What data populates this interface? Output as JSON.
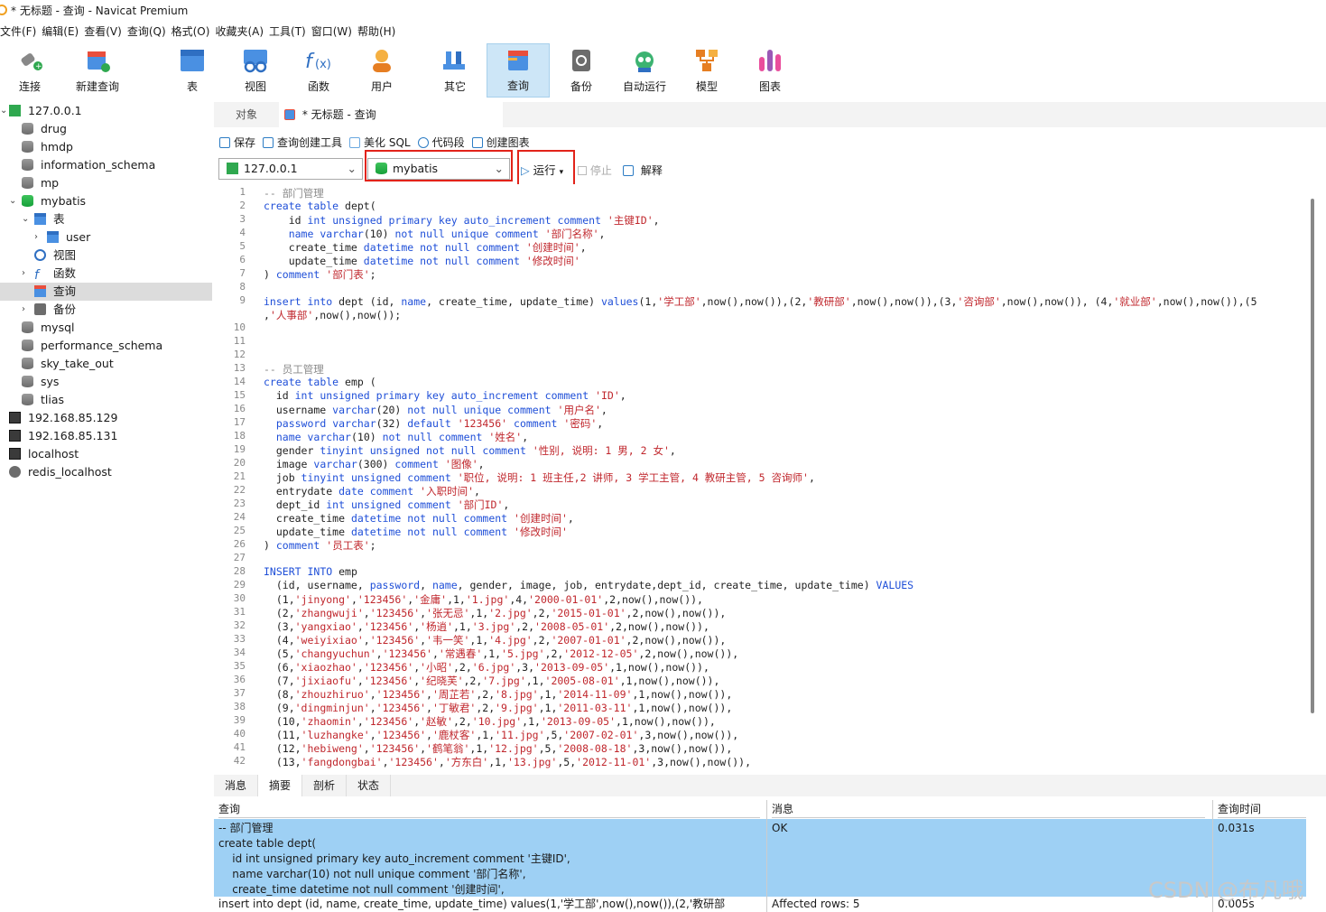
{
  "window": {
    "title": "* 无标题 - 查询 - Navicat Premium"
  },
  "menu": [
    "文件(F)",
    "编辑(E)",
    "查看(V)",
    "查询(Q)",
    "格式(O)",
    "收藏夹(A)",
    "工具(T)",
    "窗口(W)",
    "帮助(H)"
  ],
  "toolbar": [
    {
      "label": "连接",
      "icon": "plug-icon"
    },
    {
      "label": "新建查询",
      "icon": "new-query-icon"
    },
    {
      "label": "表",
      "icon": "table-icon"
    },
    {
      "label": "视图",
      "icon": "view-icon"
    },
    {
      "label": "函数",
      "icon": "function-icon"
    },
    {
      "label": "用户",
      "icon": "user-icon"
    },
    {
      "label": "其它",
      "icon": "tools-icon"
    },
    {
      "label": "查询",
      "icon": "query-icon"
    },
    {
      "label": "备份",
      "icon": "backup-icon"
    },
    {
      "label": "自动运行",
      "icon": "robot-icon"
    },
    {
      "label": "模型",
      "icon": "model-icon"
    },
    {
      "label": "图表",
      "icon": "chart-icon"
    }
  ],
  "tree": [
    {
      "label": "127.0.0.1",
      "kind": "conn-green"
    },
    {
      "label": "drug",
      "kind": "db"
    },
    {
      "label": "hmdp",
      "kind": "db"
    },
    {
      "label": "information_schema",
      "kind": "db"
    },
    {
      "label": "mp",
      "kind": "db"
    },
    {
      "label": "mybatis",
      "kind": "db-green"
    },
    {
      "label": "表",
      "kind": "folder-table"
    },
    {
      "label": "user",
      "kind": "table"
    },
    {
      "label": "视图",
      "kind": "view"
    },
    {
      "label": "函数",
      "kind": "func"
    },
    {
      "label": "查询",
      "kind": "query"
    },
    {
      "label": "备份",
      "kind": "backup"
    },
    {
      "label": "mysql",
      "kind": "db"
    },
    {
      "label": "performance_schema",
      "kind": "db"
    },
    {
      "label": "sky_take_out",
      "kind": "db"
    },
    {
      "label": "sys",
      "kind": "db"
    },
    {
      "label": "tlias",
      "kind": "db"
    },
    {
      "label": "192.168.85.129",
      "kind": "conn"
    },
    {
      "label": "192.168.85.131",
      "kind": "conn"
    },
    {
      "label": "localhost",
      "kind": "conn"
    },
    {
      "label": "redis_localhost",
      "kind": "redis"
    }
  ],
  "tabs": {
    "objects": "对象",
    "query": "* 无标题 - 查询"
  },
  "qtools": [
    "保存",
    "查询创建工具",
    "美化 SQL",
    "代码段",
    "创建图表"
  ],
  "connection_select": "127.0.0.1",
  "db_select": "mybatis",
  "run_label": "运行",
  "stop_label": "停止",
  "explain_label": "解释",
  "code": [
    "-- 部门管理",
    "create table dept(",
    "    id int unsigned primary key auto_increment comment '主键ID',",
    "    name varchar(10) not null unique comment '部门名称',",
    "    create_time datetime not null comment '创建时间',",
    "    update_time datetime not null comment '修改时间'",
    ") comment '部门表';",
    "",
    "insert into dept (id, name, create_time, update_time) values(1,'学工部',now(),now()),(2,'教研部',now(),now()),(3,'咨询部',now(),now()), (4,'就业部',now(),now()),(5",
    ",'人事部',now(),now());",
    "",
    "",
    "",
    "-- 员工管理",
    "create table emp (",
    "  id int unsigned primary key auto_increment comment 'ID',",
    "  username varchar(20) not null unique comment '用户名',",
    "  password varchar(32) default '123456' comment '密码',",
    "  name varchar(10) not null comment '姓名',",
    "  gender tinyint unsigned not null comment '性别, 说明: 1 男, 2 女',",
    "  image varchar(300) comment '图像',",
    "  job tinyint unsigned comment '职位, 说明: 1 班主任,2 讲师, 3 学工主管, 4 教研主管, 5 咨询师',",
    "  entrydate date comment '入职时间',",
    "  dept_id int unsigned comment '部门ID',",
    "  create_time datetime not null comment '创建时间',",
    "  update_time datetime not null comment '修改时间'",
    ") comment '员工表';",
    "",
    "INSERT INTO emp",
    "  (id, username, password, name, gender, image, job, entrydate,dept_id, create_time, update_time) VALUES",
    "  (1,'jinyong','123456','金庸',1,'1.jpg',4,'2000-01-01',2,now(),now()),",
    "  (2,'zhangwuji','123456','张无忌',1,'2.jpg',2,'2015-01-01',2,now(),now()),",
    "  (3,'yangxiao','123456','杨逍',1,'3.jpg',2,'2008-05-01',2,now(),now()),",
    "  (4,'weiyixiao','123456','韦一笑',1,'4.jpg',2,'2007-01-01',2,now(),now()),",
    "  (5,'changyuchun','123456','常遇春',1,'5.jpg',2,'2012-12-05',2,now(),now()),",
    "  (6,'xiaozhao','123456','小昭',2,'6.jpg',3,'2013-09-05',1,now(),now()),",
    "  (7,'jixiaofu','123456','纪晓芙',2,'7.jpg',1,'2005-08-01',1,now(),now()),",
    "  (8,'zhouzhiruo','123456','周芷若',2,'8.jpg',1,'2014-11-09',1,now(),now()),",
    "  (9,'dingminjun','123456','丁敏君',2,'9.jpg',1,'2011-03-11',1,now(),now()),",
    "  (10,'zhaomin','123456','赵敏',2,'10.jpg',1,'2013-09-05',1,now(),now()),",
    "  (11,'luzhangke','123456','鹿杖客',1,'11.jpg',5,'2007-02-01',3,now(),now()),",
    "  (12,'hebiweng','123456','鹤笔翁',1,'12.jpg',5,'2008-08-18',3,now(),now()),",
    "  (13,'fangdongbai','123456','方东白',1,'13.jpg',5,'2012-11-01',3,now(),now()),"
  ],
  "bottom_tabs": [
    "消息",
    "摘要",
    "剖析",
    "状态"
  ],
  "result": {
    "headers": [
      "查询",
      "消息",
      "查询时间"
    ],
    "row1": {
      "query": "-- 部门管理\ncreate table dept(\n    id int unsigned primary key auto_increment comment '主键ID',\n    name varchar(10) not null unique comment '部门名称',\n    create_time datetime not null comment '创建时间',",
      "msg": "OK",
      "time": "0.031s"
    },
    "row2": {
      "query": "insert into dept (id, name, create_time, update_time) values(1,'学工部',now(),now()),(2,'教研部",
      "msg": "Affected rows: 5",
      "time": "0.005s"
    }
  },
  "watermark": "CSDN @布凡哦"
}
